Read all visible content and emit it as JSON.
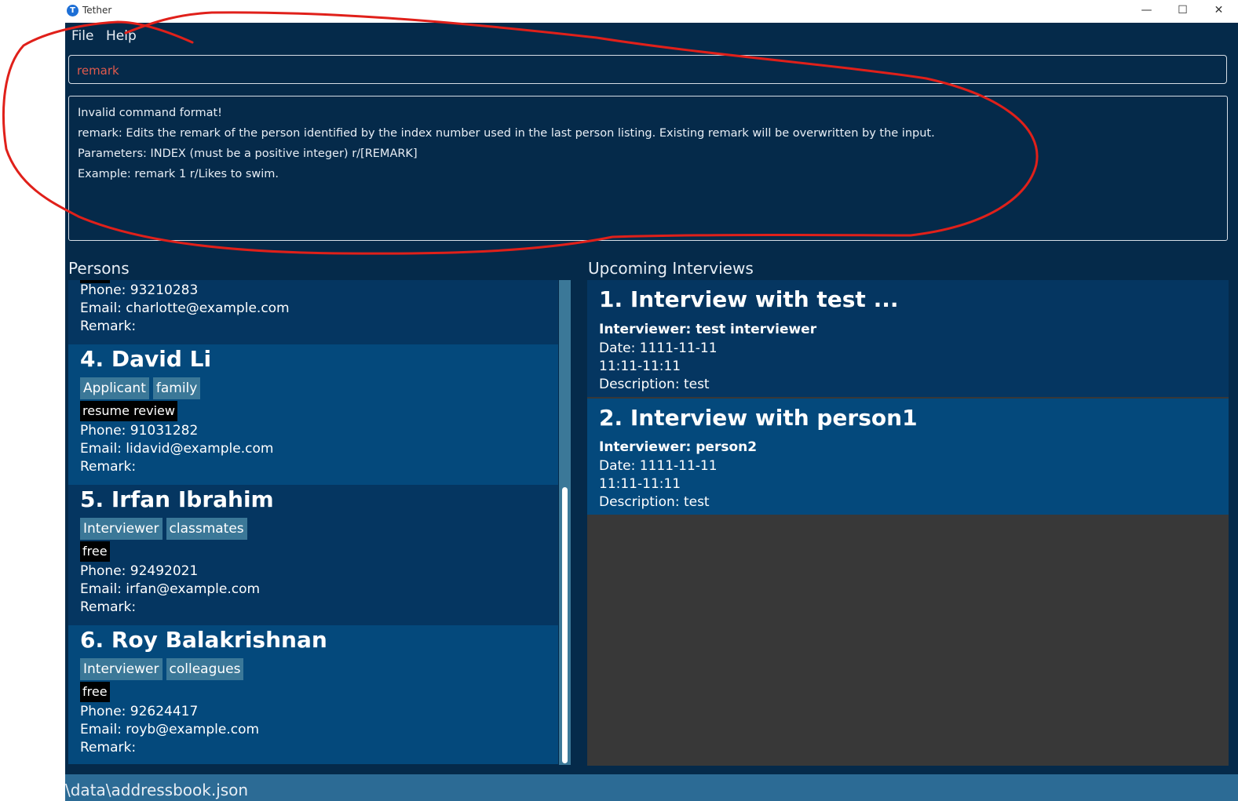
{
  "window": {
    "title": "Tether",
    "logo_letter": "T",
    "minimize_glyph": "—",
    "maximize_glyph": "☐",
    "close_glyph": "✕"
  },
  "menu": {
    "file": "File",
    "help": "Help"
  },
  "command_box": {
    "value": "remark"
  },
  "result": {
    "lines": [
      "Invalid command format!",
      "remark: Edits the remark of the person identified by the index number used in the last person listing. Existing remark will be overwritten by the input.",
      "Parameters: INDEX (must be a positive integer) r/[REMARK]",
      "Example: remark 1 r/Likes to swim."
    ]
  },
  "persons_panel": {
    "label": "Persons",
    "partial_card": {
      "phone": "Phone: 93210283",
      "email": "Email: charlotte@example.com",
      "remark": "Remark:"
    },
    "cards": [
      {
        "name": "4.  David Li",
        "tags": [
          "Applicant",
          "family"
        ],
        "status": "resume review",
        "phone": "Phone: 91031282",
        "email": "Email: lidavid@example.com",
        "remark": "Remark:"
      },
      {
        "name": "5.  Irfan Ibrahim",
        "tags": [
          "Interviewer",
          "classmates"
        ],
        "status": "free",
        "phone": "Phone: 92492021",
        "email": "Email: irfan@example.com",
        "remark": "Remark:"
      },
      {
        "name": "6.  Roy Balakrishnan",
        "tags": [
          "Interviewer",
          "colleagues"
        ],
        "status": "free",
        "phone": "Phone: 92624417",
        "email": "Email: royb@example.com",
        "remark": "Remark:"
      }
    ]
  },
  "interviews_panel": {
    "label": "Upcoming Interviews",
    "cards": [
      {
        "title": "1.  Interview with test ...",
        "interviewer": "Interviewer: test interviewer",
        "date": "Date: 1111-11-11",
        "time": "11:11-11:11",
        "description": "Description: test"
      },
      {
        "title": "2.  Interview with person1",
        "interviewer": "Interviewer: person2",
        "date": "Date: 1111-11-11",
        "time": "11:11-11:11",
        "description": "Description: test"
      }
    ]
  },
  "status_bar": {
    "path": "\\data\\addressbook.json"
  },
  "colors": {
    "background": "#052a4a",
    "card_dark": "#053661",
    "card_light": "#04497c",
    "tag": "#3b7898",
    "command_text": "#e05a4d",
    "annotation": "#e0201a",
    "status_bar": "#2c6b95"
  }
}
